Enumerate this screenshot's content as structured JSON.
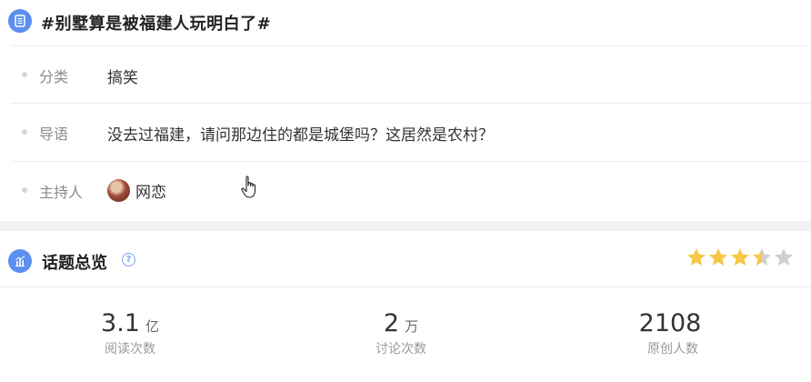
{
  "topic": {
    "title": "#别墅算是被福建人玩明白了#",
    "category_label": "分类",
    "category_value": "搞笑",
    "intro_label": "导语",
    "intro_value": "没去过福建，请问那边住的都是城堡吗？这居然是农村？",
    "host_label": "主持人",
    "host_name": "网恋"
  },
  "overview": {
    "title": "话题总览",
    "help_glyph": "?",
    "rating_stars": 3.5,
    "rating_max": 5,
    "star_color": "#f7c846",
    "star_empty_color": "#cfcfcf",
    "stats": [
      {
        "num": "3.1",
        "unit": "亿",
        "caption": "阅读次数"
      },
      {
        "num": "2",
        "unit": "万",
        "caption": "讨论次数"
      },
      {
        "num": "2108",
        "unit": "",
        "caption": "原创人数"
      }
    ]
  },
  "icons": {
    "header": "list-icon",
    "overview": "chart-icon",
    "cursor": "hand-pointer-icon"
  },
  "colors": {
    "accent": "#5b8ff0"
  }
}
